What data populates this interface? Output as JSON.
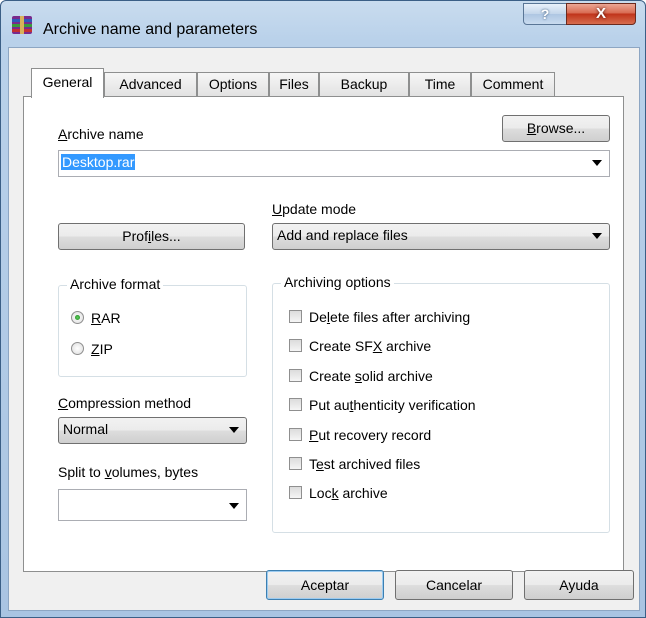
{
  "window": {
    "title": "Archive name and parameters",
    "help_glyph": "?",
    "close_glyph": "X"
  },
  "tabs": [
    {
      "label": "General"
    },
    {
      "label": "Advanced"
    },
    {
      "label": "Options"
    },
    {
      "label": "Files"
    },
    {
      "label": "Backup"
    },
    {
      "label": "Time"
    },
    {
      "label": "Comment"
    }
  ],
  "archive_name": {
    "label_a": "A",
    "label_b": "rchive name",
    "value": "Desktop.rar"
  },
  "browse_button": {
    "a": "B",
    "b": "rowse..."
  },
  "profiles_button": {
    "a": "Prof",
    "b": "i",
    "c": "les..."
  },
  "update_mode": {
    "label_a": "U",
    "label_b": "pdate mode",
    "value": "Add and replace files"
  },
  "archive_format": {
    "title": "Archive format",
    "rar": {
      "a": "R",
      "b": "AR",
      "selected": true
    },
    "zip": {
      "a": "Z",
      "b": "IP",
      "selected": false
    }
  },
  "compression": {
    "label_a": "C",
    "label_b": "ompression method",
    "value": "Normal"
  },
  "split": {
    "label_a": "Split to ",
    "label_b": "v",
    "label_c": "olumes, bytes",
    "value": ""
  },
  "archiving_options": {
    "title": "Archiving options",
    "items": [
      {
        "a": "De",
        "u": "l",
        "b": "ete files after archiving",
        "checked": false
      },
      {
        "a": "Create SF",
        "u": "X",
        "b": " archive",
        "checked": false
      },
      {
        "a": "Create ",
        "u": "s",
        "b": "olid archive",
        "checked": false
      },
      {
        "a": "Put au",
        "u": "t",
        "b": "henticity verification",
        "checked": false
      },
      {
        "a": "",
        "u": "P",
        "b": "ut recovery record",
        "checked": false
      },
      {
        "a": "T",
        "u": "e",
        "b": "st archived files",
        "checked": false
      },
      {
        "a": "Loc",
        "u": "k",
        "b": " archive",
        "checked": false
      }
    ]
  },
  "footer": {
    "ok": "Aceptar",
    "cancel": "Cancelar",
    "help": "Ayuda"
  },
  "colors": {
    "selection": "#3399ff",
    "titlebar": "#b9d1ea",
    "close": "#c0331a"
  }
}
